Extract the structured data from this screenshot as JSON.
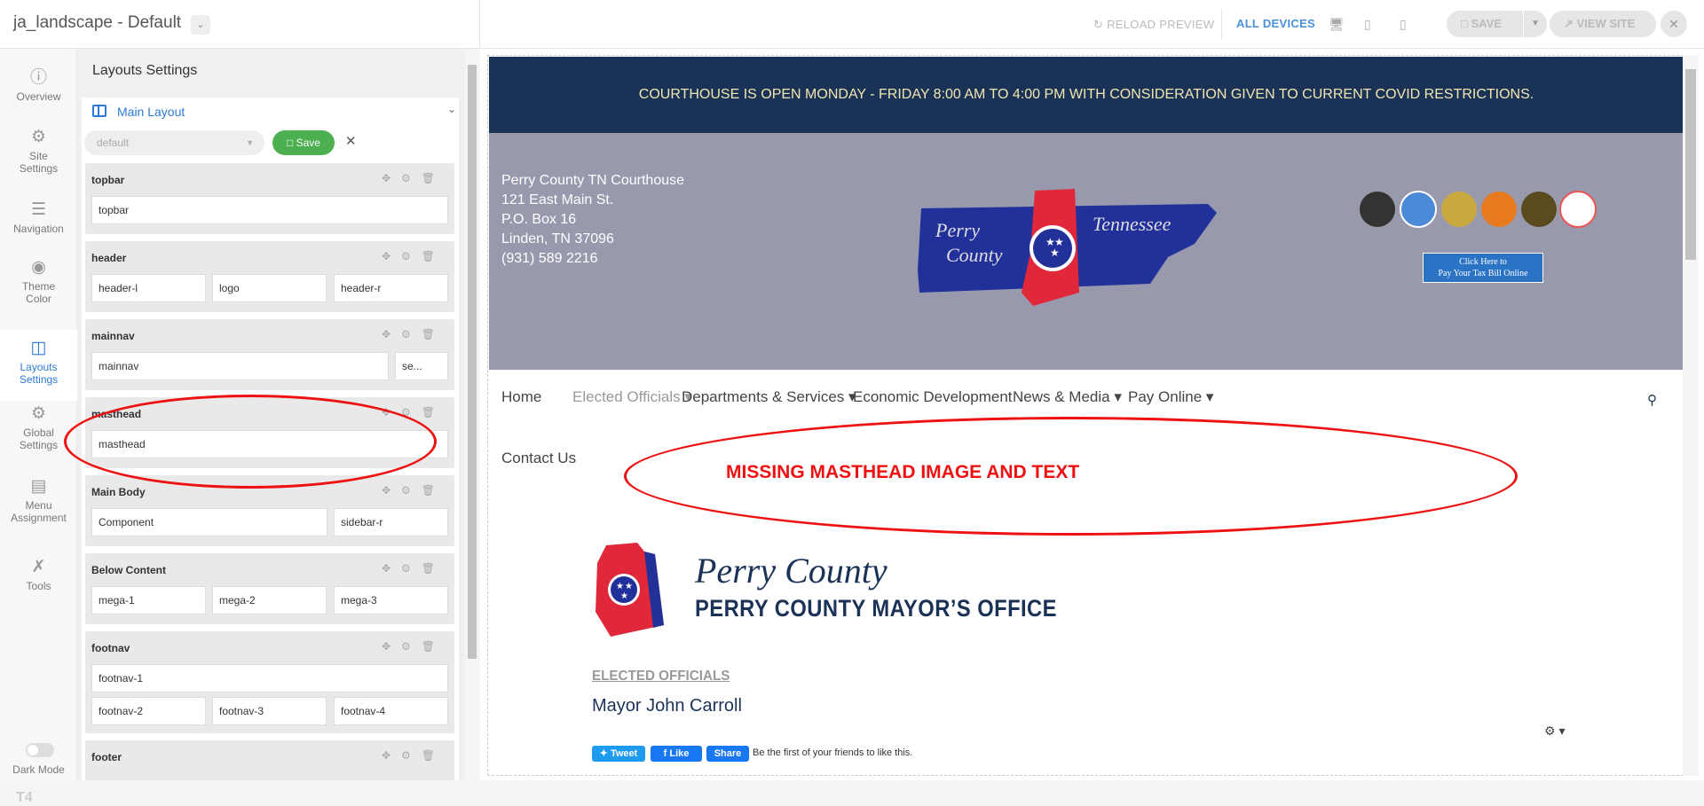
{
  "app": {
    "title": "ja_landscape - Default"
  },
  "toolbar": {
    "reload": "RELOAD PREVIEW",
    "all_devices": "ALL DEVICES",
    "save": "SAVE",
    "view_site": "VIEW SITE"
  },
  "sidenav": {
    "items": [
      {
        "label": "Overview",
        "icon": "info-icon"
      },
      {
        "label": "Site Settings",
        "icon": "gear-icon"
      },
      {
        "label": "Navigation",
        "icon": "menu-icon"
      },
      {
        "label": "Theme Color",
        "icon": "palette-icon"
      },
      {
        "label": "Layouts Settings",
        "icon": "layout-icon"
      },
      {
        "label": "Global Settings",
        "icon": "gears-icon"
      },
      {
        "label": "Menu Assignment",
        "icon": "list-icon"
      },
      {
        "label": "Tools",
        "icon": "tools-icon"
      }
    ],
    "dark_mode": "Dark Mode",
    "logo": "T4"
  },
  "layout": {
    "heading": "Layouts Settings",
    "main_layout": "Main Layout",
    "preset": "default",
    "save": "Save",
    "sections": [
      {
        "name": "topbar",
        "cells": [
          "topbar"
        ]
      },
      {
        "name": "header",
        "cells": [
          "header-l",
          "logo",
          "header-r"
        ]
      },
      {
        "name": "mainnav",
        "cells": [
          "mainnav",
          "se..."
        ]
      },
      {
        "name": "masthead",
        "cells": [
          "masthead"
        ]
      },
      {
        "name": "Main Body",
        "cells": [
          "Component",
          "sidebar-r"
        ]
      },
      {
        "name": "Below Content",
        "cells": [
          "mega-1",
          "mega-2",
          "mega-3"
        ]
      },
      {
        "name": "footnav",
        "cells": [
          "footnav-1",
          "footnav-2",
          "footnav-3",
          "footnav-4"
        ]
      },
      {
        "name": "footer",
        "cells": []
      }
    ]
  },
  "preview": {
    "announcement": "COURTHOUSE IS OPEN MONDAY - FRIDAY 8:00 AM TO 4:00 PM WITH CONSIDERATION GIVEN TO CURRENT COVID RESTRICTIONS.",
    "address": [
      "Perry County TN Courthouse",
      "121 East Main St.",
      "P.O. Box 16",
      "Linden, TN 37096",
      "(931) 589 2216"
    ],
    "logo_text": {
      "left1": "Perry",
      "left2": "County",
      "right": "Tennessee"
    },
    "tax_button": [
      "Click Here to",
      "Pay Your Tax Bill Online"
    ],
    "nav": [
      {
        "label": "Home",
        "muted": false
      },
      {
        "label": "Elected Officials ▾",
        "muted": true
      },
      {
        "label": "Departments & Services ▾",
        "muted": false
      },
      {
        "label": "Economic Development",
        "muted": false
      },
      {
        "label": "News & Media ▾",
        "muted": false
      },
      {
        "label": "Pay Online ▾",
        "muted": false
      },
      {
        "label": "Contact Us",
        "muted": false
      }
    ],
    "annotation": "MISSING MASTHEAD IMAGE AND TEXT",
    "org_title": "Perry County",
    "org_subtitle": "PERRY COUNTY MAYOR’S OFFICE",
    "category": "ELECTED OFFICIALS",
    "mayor": "Mayor John Carroll",
    "social": {
      "tweet": "Tweet",
      "like": "Like",
      "share": "Share",
      "first": "Be the first of your friends to like this."
    }
  },
  "colors": {
    "accent": "#2b7bd6",
    "navy": "#1b3257",
    "banner": "#9899ac",
    "annotation": "#ee1111",
    "save_green": "#4caf50"
  }
}
